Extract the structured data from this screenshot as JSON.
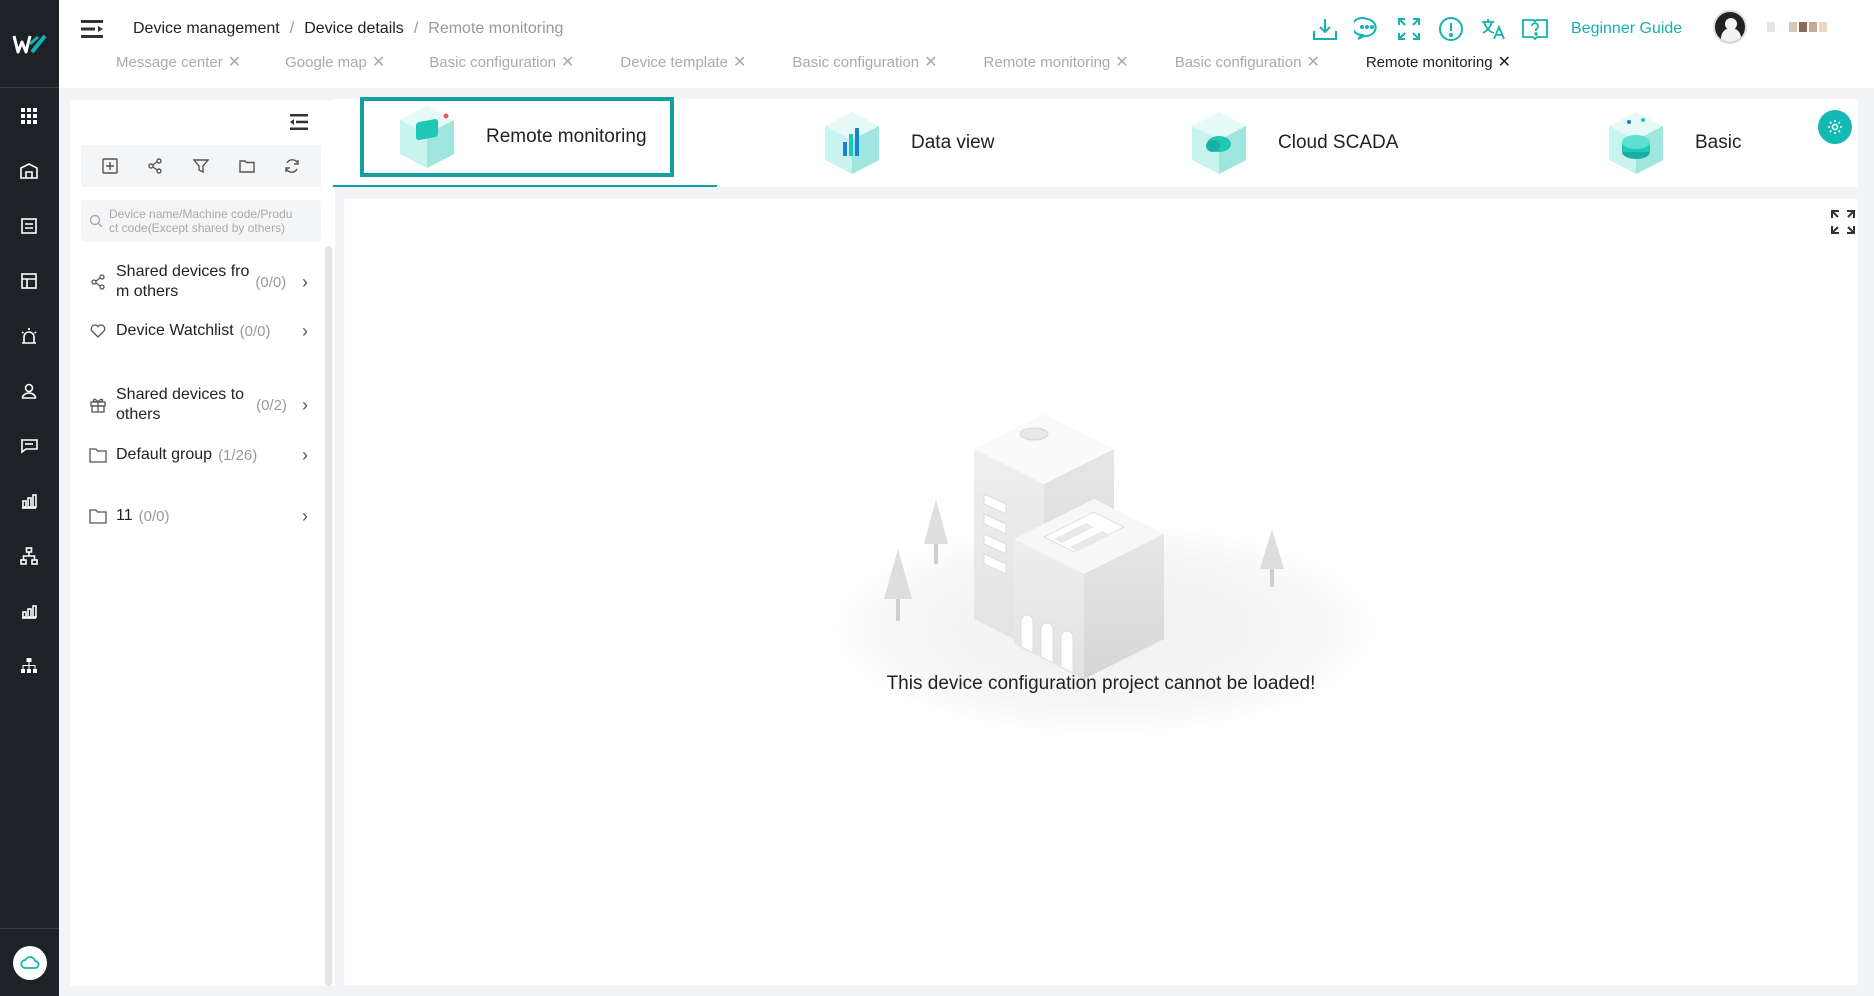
{
  "breadcrumb": {
    "root": "Device management",
    "separator": "/",
    "middle": "Device details",
    "current": "Remote monitoring"
  },
  "header": {
    "beginner_guide": "Beginner Guide",
    "accent": "#14b3b0"
  },
  "open_tabs": [
    {
      "label": "Message center",
      "active": false
    },
    {
      "label": "Google map",
      "active": false
    },
    {
      "label": "Basic configuration",
      "active": false
    },
    {
      "label": "Device template",
      "active": false
    },
    {
      "label": "Basic configuration",
      "active": false
    },
    {
      "label": "Remote monitoring",
      "active": false
    },
    {
      "label": "Basic configuration",
      "active": false
    },
    {
      "label": "Remote monitoring",
      "active": true
    }
  ],
  "sidebar": {
    "search_placeholder_line1": "Device name/Machine code/Produ",
    "search_placeholder_line2": "ct code(Except shared by others)",
    "items": [
      {
        "label_line1": "Shared devices fro",
        "label_line2": "m others",
        "count": "(0/0)",
        "icon": "share-icon"
      },
      {
        "label_line1": "Device Watchlist",
        "count": "(0/0)",
        "icon": "heart-icon"
      },
      {
        "label_line1": "Shared devices to",
        "label_line2": "others",
        "count": "(0/2)",
        "icon": "gift-icon"
      },
      {
        "label_line1": "Default group",
        "count": "(1/26)",
        "icon": "folder-icon"
      },
      {
        "label_line1": "11",
        "count": "(0/0)",
        "icon": "folder-icon"
      }
    ]
  },
  "main_tabs": [
    {
      "label": "Remote monitoring",
      "active": true
    },
    {
      "label": "Data view",
      "active": false
    },
    {
      "label": "Cloud SCADA",
      "active": false
    },
    {
      "label": "Basic",
      "active": false
    }
  ],
  "content": {
    "message": "This device configuration project cannot be loaded!"
  }
}
